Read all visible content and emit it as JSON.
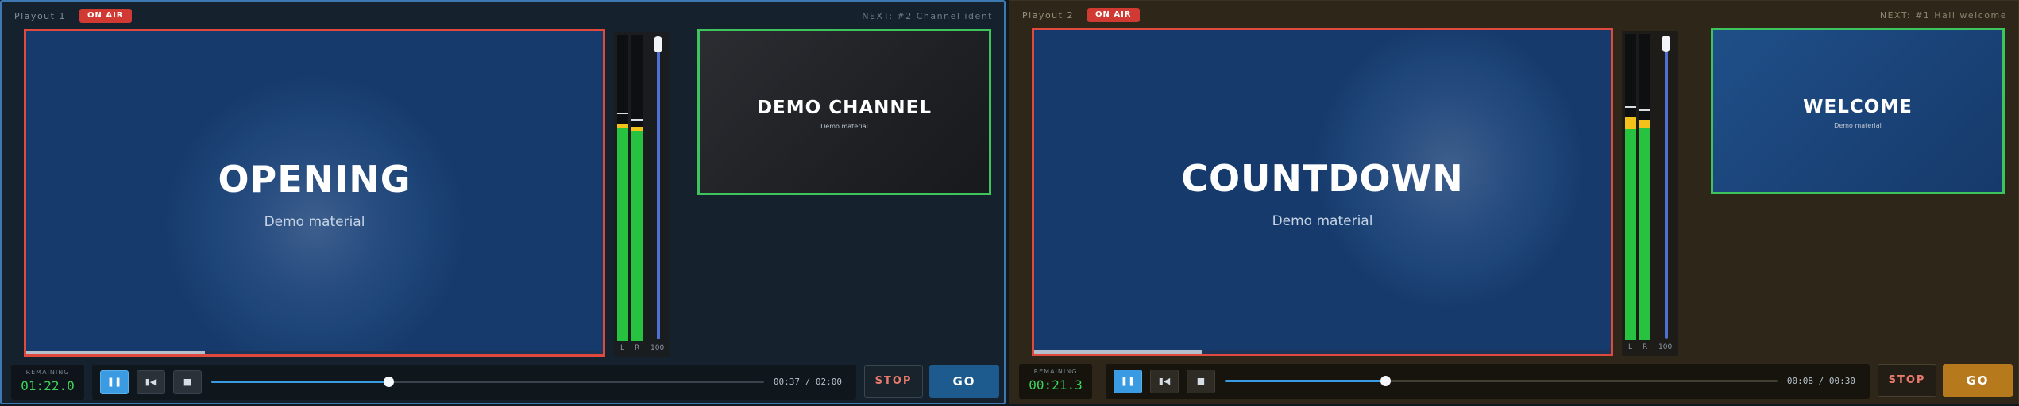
{
  "playouts": [
    {
      "title": "Playout 1",
      "on_air": "ON AIR",
      "next": "NEXT: #2  Channel ident",
      "program": {
        "title": "OPENING",
        "subtitle": "Demo material",
        "progress": 0.31
      },
      "meter": {
        "left_level": 0.71,
        "right_level": 0.7,
        "left_peak": 0.74,
        "right_peak": 0.72,
        "l_label": "L",
        "r_label": "R",
        "volume_label": "100",
        "volume": 1.0
      },
      "preview": {
        "title": "DEMO CHANNEL",
        "subtitle": "Demo material"
      },
      "remaining": {
        "label": "REMAINING",
        "value": "01:22.0"
      },
      "transport": {
        "seek": 0.32,
        "time": "00:37 / 02:00"
      },
      "stop_label": "STOP",
      "go_label": "GO"
    },
    {
      "title": "Playout 2",
      "on_air": "ON AIR",
      "next": "NEXT: #1  Hall welcome",
      "program": {
        "title": "COUNTDOWN",
        "subtitle": "Demo material",
        "progress": 0.29
      },
      "meter": {
        "left_level": 0.73,
        "right_level": 0.72,
        "left_peak": 0.76,
        "right_peak": 0.75,
        "l_label": "L",
        "r_label": "R",
        "volume_label": "100",
        "volume": 1.0
      },
      "preview": {
        "title": "WELCOME",
        "subtitle": "Demo material"
      },
      "remaining": {
        "label": "REMAINING",
        "value": "00:21.3"
      },
      "transport": {
        "seek": 0.29,
        "time": "00:08 / 00:30"
      },
      "stop_label": "STOP",
      "go_label": "GO"
    }
  ],
  "icons": {
    "pause": "pause-icon",
    "skip_back": "skip-back-icon",
    "stop": "stop-icon"
  },
  "colors": {
    "on_air": "#d13a32",
    "program_border": "#e04a3e",
    "preview_border": "#3ec45d",
    "accent": "#3a9be2",
    "go_p1": "#1d5b8e",
    "go_p2": "#b6791c"
  }
}
